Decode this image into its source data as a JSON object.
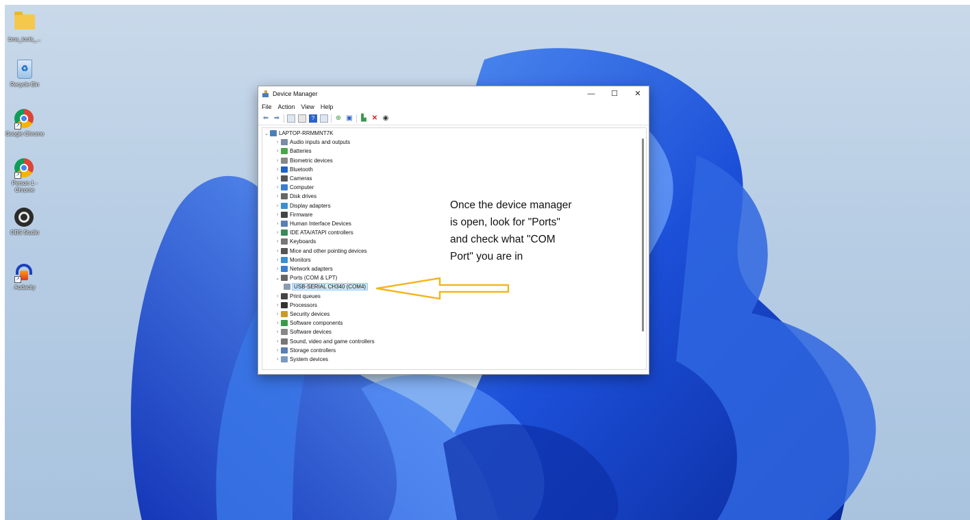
{
  "desktop_icons": [
    {
      "label": "bms_tools_...",
      "icon": "folder-icon"
    },
    {
      "label": "Recycle Bin",
      "icon": "recycle-bin-icon"
    },
    {
      "label": "Google Chrome",
      "icon": "chrome-icon"
    },
    {
      "label": "Person 1 - Chrome",
      "icon": "chrome-profile-icon"
    },
    {
      "label": "OBS Studio",
      "icon": "obs-icon"
    },
    {
      "label": "Audacity",
      "icon": "audacity-icon"
    }
  ],
  "window": {
    "title": "Device Manager",
    "controls": {
      "minimize": "—",
      "maximize": "☐",
      "close": "✕"
    },
    "menu": [
      "File",
      "Action",
      "View",
      "Help"
    ]
  },
  "tree": {
    "root": "LAPTOP-RRMMNT7K",
    "items": [
      {
        "label": "Audio inputs and outputs",
        "expanded": false
      },
      {
        "label": "Batteries",
        "expanded": false
      },
      {
        "label": "Biometric devices",
        "expanded": false
      },
      {
        "label": "Bluetooth",
        "expanded": false
      },
      {
        "label": "Cameras",
        "expanded": false
      },
      {
        "label": "Computer",
        "expanded": false
      },
      {
        "label": "Disk drives",
        "expanded": false
      },
      {
        "label": "Display adapters",
        "expanded": false
      },
      {
        "label": "Firmware",
        "expanded": false
      },
      {
        "label": "Human Interface Devices",
        "expanded": false
      },
      {
        "label": "IDE ATA/ATAPI controllers",
        "expanded": false
      },
      {
        "label": "Keyboards",
        "expanded": false
      },
      {
        "label": "Mice and other pointing devices",
        "expanded": false
      },
      {
        "label": "Monitors",
        "expanded": false
      },
      {
        "label": "Network adapters",
        "expanded": false
      },
      {
        "label": "Ports (COM & LPT)",
        "expanded": true
      },
      {
        "label": "USB-SERIAL CH340 (COM4)",
        "child": true,
        "selected": true
      },
      {
        "label": "Print queues",
        "expanded": false
      },
      {
        "label": "Processors",
        "expanded": false
      },
      {
        "label": "Security devices",
        "expanded": false
      },
      {
        "label": "Software components",
        "expanded": false
      },
      {
        "label": "Software devices",
        "expanded": false
      },
      {
        "label": "Sound, video and game controllers",
        "expanded": false
      },
      {
        "label": "Storage controllers",
        "expanded": false
      },
      {
        "label": "System devices",
        "expanded": false
      }
    ]
  },
  "annotation": {
    "text": "Once the device manager\nis open, look for \"Ports\"\nand check what \"COM\nPort\" you are in",
    "arrow_color": "#f2b61f"
  },
  "colors": {
    "accent": "#0067c0",
    "selection": "#cde8ff"
  }
}
